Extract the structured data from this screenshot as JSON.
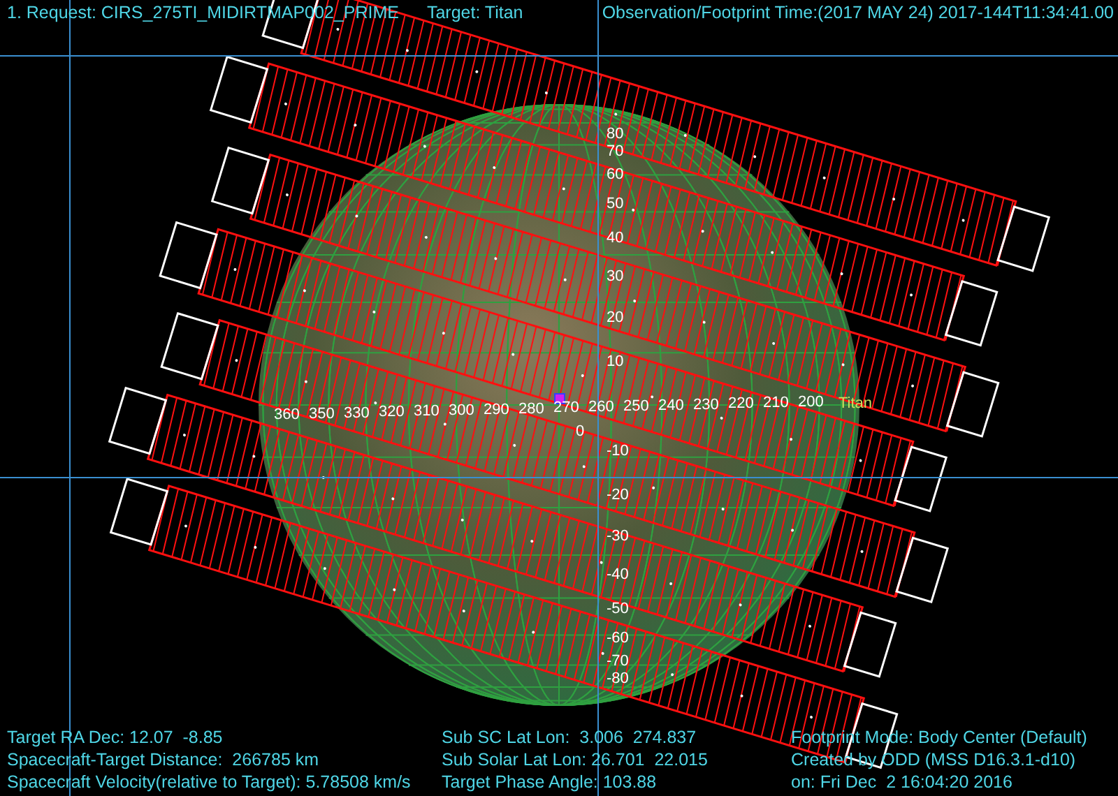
{
  "header": {
    "request": "1. Request: CIRS_275TI_MIDIRTMAP002_PRIME",
    "target": "Target: Titan",
    "time": "Observation/Footprint Time:(2017 MAY 24) 2017-144T11:34:41.00"
  },
  "globe": {
    "body_label": "Titan",
    "lat_labels": [
      "80",
      "70",
      "60",
      "50",
      "40",
      "30",
      "20",
      "10",
      "0",
      "-10",
      "-20",
      "-30",
      "-40",
      "-50",
      "-60",
      "-70",
      "-80"
    ],
    "lon_labels": [
      "360",
      "350",
      "330",
      "320",
      "310",
      "300",
      "290",
      "280",
      "270",
      "260",
      "250",
      "240",
      "230",
      "220",
      "210",
      "200"
    ]
  },
  "footer": {
    "left": [
      "Target RA Dec: 12.07  -8.85",
      "Spacecraft-Target Distance:  266785 km",
      "Spacecraft Velocity(relative to Target): 5.78508 km/s"
    ],
    "middle": [
      "Sub SC Lat Lon:  3.006  274.837",
      "Sub Solar Lat Lon: 26.701  22.015",
      "Target Phase Angle: 103.88"
    ],
    "right": [
      "Footprint Mode: Body Center (Default)",
      "Created by ODD (MSS D16.3.1-d10)",
      "on: Fri Dec  2 16:04:20 2016"
    ]
  }
}
